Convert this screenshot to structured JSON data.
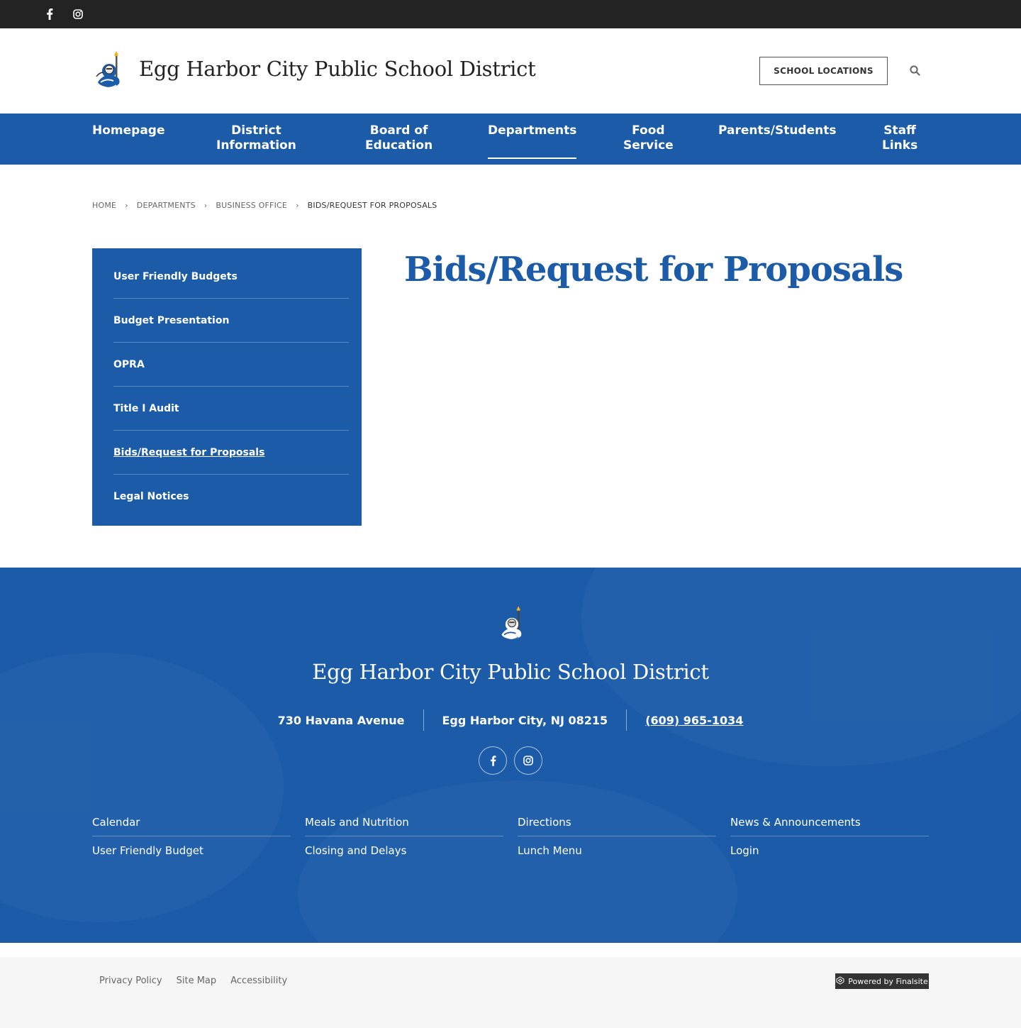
{
  "topbar": {
    "social": [
      "facebook-icon",
      "instagram-icon"
    ]
  },
  "header": {
    "site_title": "Egg Harbor City Public School District",
    "locations_label": "SCHOOL LOCATIONS"
  },
  "nav": {
    "items": [
      {
        "label": "Homepage"
      },
      {
        "label": "District\nInformation"
      },
      {
        "label": "Board of\nEducation"
      },
      {
        "label": "Departments",
        "active": true
      },
      {
        "label": "Food\nService"
      },
      {
        "label": "Parents/Students"
      },
      {
        "label": "Staff\nLinks"
      }
    ]
  },
  "breadcrumb": {
    "items": [
      "HOME",
      "DEPARTMENTS",
      "BUSINESS OFFICE",
      "BIDS/REQUEST FOR PROPOSALS"
    ]
  },
  "sidenav": {
    "items": [
      {
        "label": "User Friendly Budgets"
      },
      {
        "label": "Budget Presentation"
      },
      {
        "label": "OPRA"
      },
      {
        "label": "Title I Audit"
      },
      {
        "label": "Bids/Request for Proposals",
        "current": true
      },
      {
        "label": "Legal Notices"
      }
    ]
  },
  "page": {
    "title": "Bids/Request for Proposals"
  },
  "footer": {
    "title": "Egg Harbor City Public School District",
    "address": "730 Havana Avenue",
    "city": "Egg Harbor City, NJ  08215",
    "phone": "(609) 965-1034",
    "quicklinks": [
      [
        "Calendar",
        "User Friendly Budget"
      ],
      [
        "Meals and Nutrition",
        "Closing and Delays"
      ],
      [
        "Directions",
        "Lunch Menu"
      ],
      [
        "News & Announcements",
        "Login"
      ]
    ]
  },
  "bottombar": {
    "links": [
      "Privacy Policy",
      "Site Map",
      "Accessibility"
    ],
    "powered": "Powered by Finalsite"
  },
  "colors": {
    "brand_blue": "#1b5ba8",
    "topbar": "#232323",
    "bottom_bg": "#f6f6f6"
  }
}
